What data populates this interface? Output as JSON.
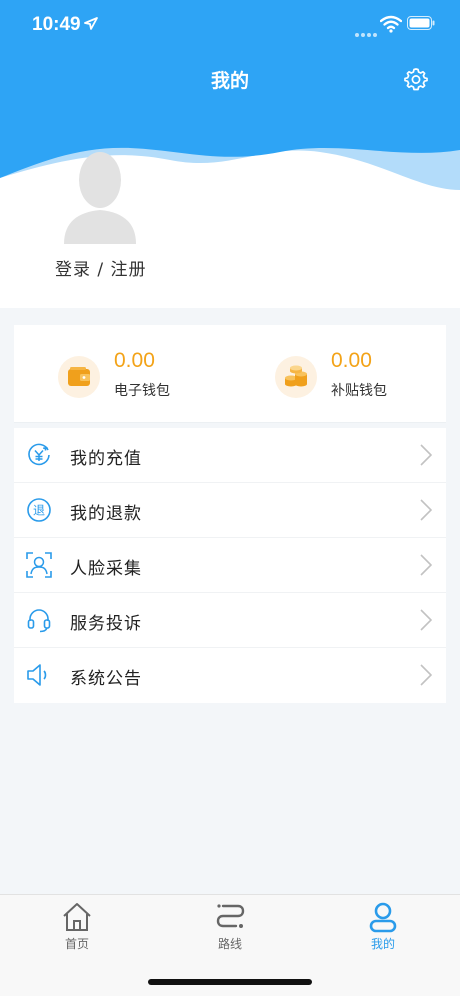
{
  "status_bar": {
    "time": "10:49"
  },
  "header": {
    "title": "我的",
    "login_label": "登录 / 注册"
  },
  "colors": {
    "primary_blue": "#2a9bea",
    "accent_orange": "#f3a318",
    "background": "#f3f6f9"
  },
  "wallets": [
    {
      "amount": "0.00",
      "label": "电子钱包",
      "icon": "wallet-icon"
    },
    {
      "amount": "0.00",
      "label": "补贴钱包",
      "icon": "coins-icon"
    }
  ],
  "menu": [
    {
      "label": "我的充值",
      "icon": "recharge-icon"
    },
    {
      "label": "我的退款",
      "icon": "refund-icon"
    },
    {
      "label": "人脸采集",
      "icon": "face-scan-icon"
    },
    {
      "label": "服务投诉",
      "icon": "headset-icon"
    },
    {
      "label": "系统公告",
      "icon": "speaker-icon"
    }
  ],
  "tabs": [
    {
      "label": "首页",
      "icon": "home-icon"
    },
    {
      "label": "路线",
      "icon": "route-icon"
    },
    {
      "label": "我的",
      "icon": "user-icon",
      "active": true
    }
  ]
}
